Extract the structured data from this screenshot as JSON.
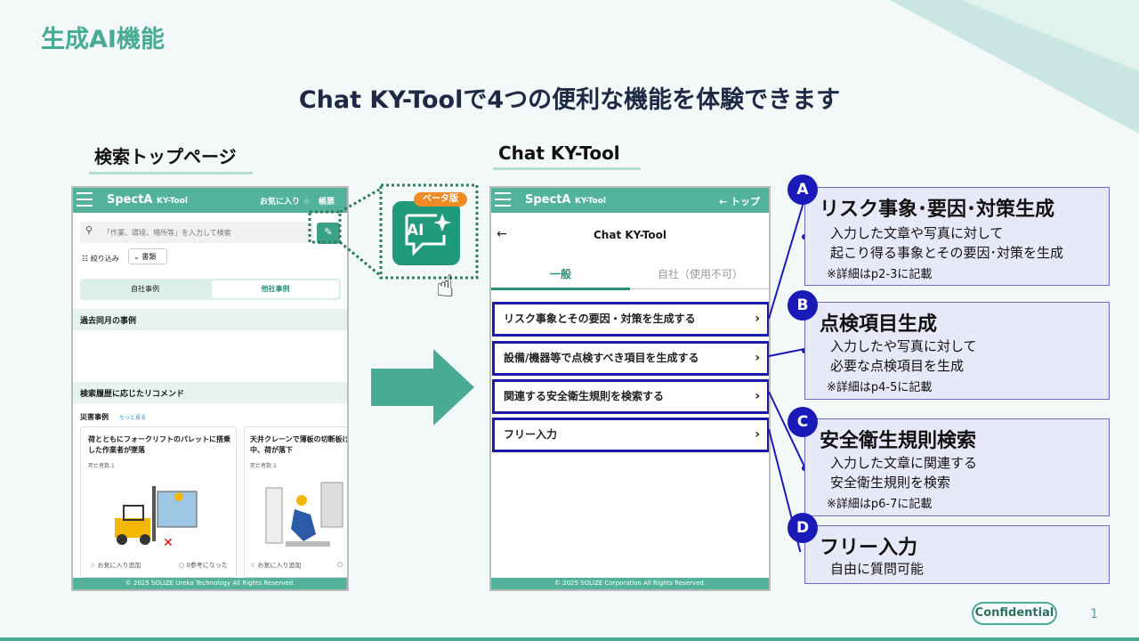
{
  "slide": {
    "title": "生成AI機能",
    "headline": "Chat KY-Toolで4つの便利な機能を体験できます",
    "confidential": "Confidential",
    "page_number": "1"
  },
  "left_section": {
    "label": "検索トップページ",
    "app": {
      "brand": "SpectA",
      "brand_sub": "KY-Tool",
      "favorites": "お気に入り ☆",
      "account": "帳票",
      "search_placeholder": "「作業、環境、場所等」を入力して検索",
      "filter_label": "絞り込み",
      "category_select": "書類",
      "tab_own": "自社事例",
      "tab_other": "他社事例",
      "section_past": "過去同月の事例",
      "section_recommend": "検索履歴に応じたリコメンド",
      "disaster_label": "災害事例",
      "more_link": "もっと見る",
      "cards": [
        {
          "title": "荷とともにフォークリフトのパレットに搭乗した作業者が墜落",
          "meta": "死亡者数:1",
          "fav": "お気に入り追加",
          "ref": "0参考になった"
        },
        {
          "title": "天井クレーンで薄板の切断板げ中、荷が落下",
          "meta": "死亡者数:1",
          "fav": "お気に入り追加",
          "ref": "0"
        }
      ],
      "footer": "© 2025 SOLIZE Ureka Technology All Rights Reserved."
    }
  },
  "ai_icon": {
    "beta_label": "ベータ版",
    "icon_text": "AI"
  },
  "right_section": {
    "label": "Chat KY-Tool",
    "app": {
      "brand": "SpectA",
      "brand_sub": "KY-Tool",
      "top_link": "← トップ",
      "screen_title": "Chat KY-Tool",
      "tab_general": "一般",
      "tab_company": "自社（使用不可）",
      "menu": [
        "リスク事象とその要因・対策を生成する",
        "設備/機器等で点検すべき項目を生成する",
        "関連する安全衛生規則を検索する",
        "フリー入力"
      ],
      "footer": "© 2025 SOLIZE Corporation All Rights Reserved."
    }
  },
  "features": [
    {
      "letter": "A",
      "title": "リスク事象･要因･対策生成",
      "lines": [
        "入力した文章や写真に対して",
        "起こり得る事象とその要因･対策を生成"
      ],
      "note": "※詳細はp2-3に記載"
    },
    {
      "letter": "B",
      "title": "点検項目生成",
      "lines": [
        "入力したや写真に対して",
        "必要な点検項目を生成"
      ],
      "note": "※詳細はp4-5に記載"
    },
    {
      "letter": "C",
      "title": "安全衛生規則検索",
      "lines": [
        "入力した文章に関連する",
        "安全衛生規則を検索"
      ],
      "note": "※詳細はp6-7に記載"
    },
    {
      "letter": "D",
      "title": "フリー入力",
      "lines": [
        "自由に質問可能"
      ],
      "note": ""
    }
  ],
  "colors": {
    "brand_green": "#4aab95",
    "app_green": "#52b29c",
    "highlight_blue": "#1a1aa8",
    "feature_bg": "#e8e9f8",
    "beta_orange": "#f08a24"
  }
}
